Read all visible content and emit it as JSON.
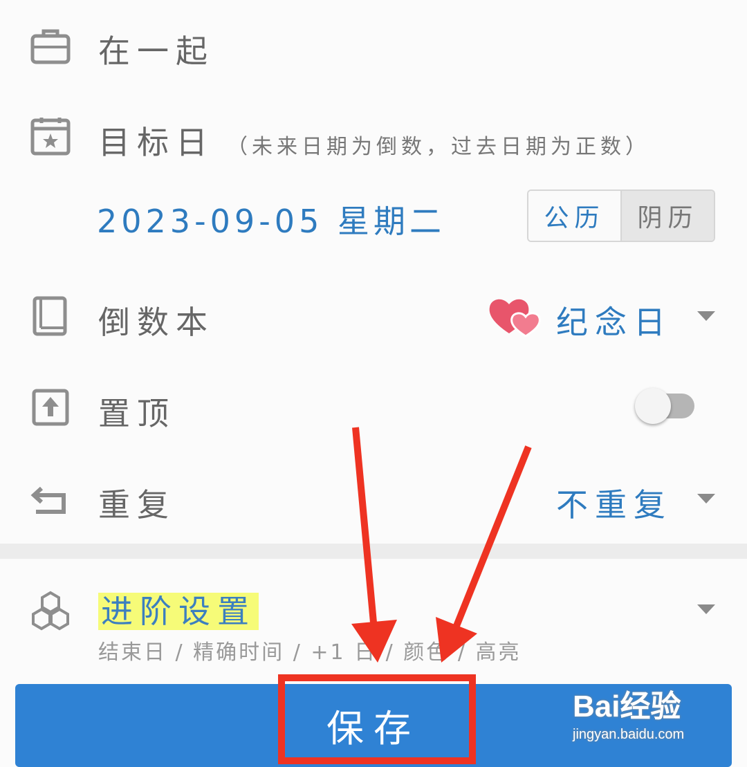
{
  "rows": {
    "together": {
      "label": "在一起",
      "icon": "briefcase-icon"
    },
    "target_date": {
      "label": "目标日",
      "note": "（未来日期为倒数，过去日期为正数）",
      "icon": "calendar-star-icon",
      "date_value": "2023-09-05 星期二",
      "calendar_solar": "公历",
      "calendar_lunar": "阴历"
    },
    "countdown_book": {
      "label": "倒数本",
      "value": "纪念日",
      "icon": "book-icon"
    },
    "pin_top": {
      "label": "置顶",
      "enabled": false,
      "icon": "pin-up-icon"
    },
    "repeat": {
      "label": "重复",
      "value": "不重复",
      "icon": "repeat-icon"
    },
    "advanced": {
      "label": "进阶设置",
      "subtitle": "结束日 / 精确时间 / +1 日 / 颜色 / 高亮",
      "icon": "cubes-icon"
    }
  },
  "save_button": {
    "label": "保存"
  },
  "watermark": {
    "brand": "Bai经验",
    "url": "jingyan.baidu.com"
  },
  "colors": {
    "accent": "#2e7bbf",
    "save": "#2f82d4",
    "annotation": "#ee3322",
    "highlight": "#f6fb78"
  }
}
